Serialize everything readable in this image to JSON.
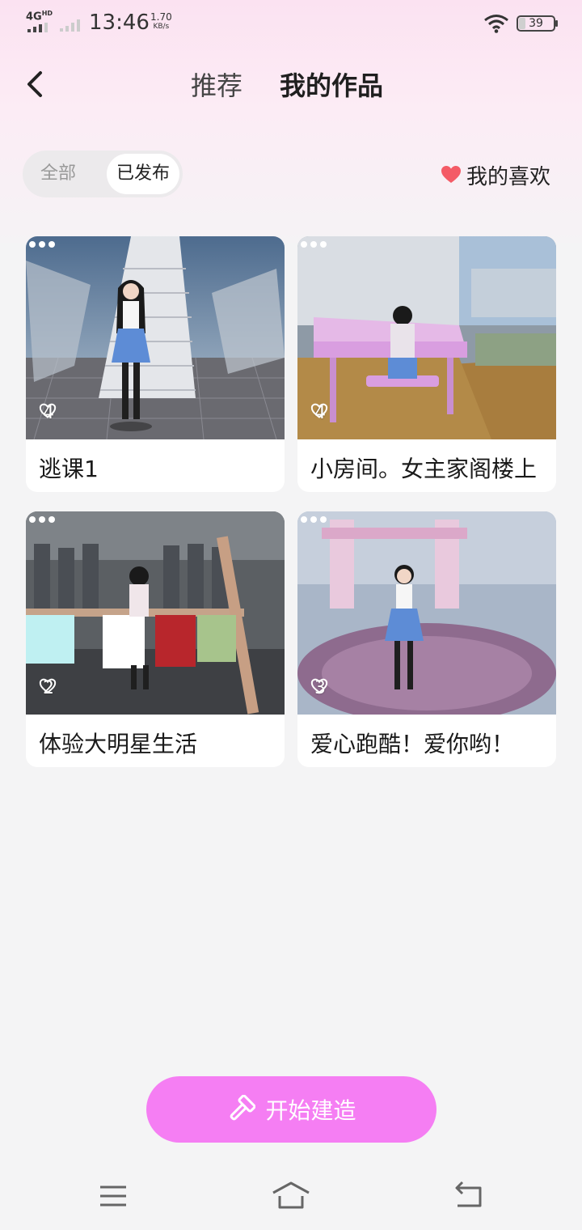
{
  "status_bar": {
    "network": "4G",
    "network_hd": "HD",
    "time": "13:46",
    "speed_value": "1.70",
    "speed_unit": "KB/s",
    "battery": "39"
  },
  "header": {
    "tab_recommend": "推荐",
    "tab_mine": "我的作品",
    "active_tab": "我的作品"
  },
  "filters": {
    "all": "全部",
    "published": "已发布",
    "selected": "已发布"
  },
  "likes_link": "我的喜欢",
  "works": [
    {
      "title": "逃课1",
      "likes": "4"
    },
    {
      "title": "小房间。女主家阁楼上",
      "likes": "4"
    },
    {
      "title": "体验大明星生活",
      "likes": "2"
    },
    {
      "title": "爱心跑酷！爱你哟！",
      "likes": "3"
    }
  ],
  "build_button": "开始建造",
  "colors": {
    "accent_pink": "#f57ef3",
    "heart_red": "#f45b66",
    "header_gradient_top": "#fbe2f1"
  },
  "icons": [
    "back-icon",
    "heart-icon",
    "more-icon",
    "heart-outline-icon",
    "hammer-icon",
    "menu-icon",
    "home-icon",
    "return-icon"
  ]
}
